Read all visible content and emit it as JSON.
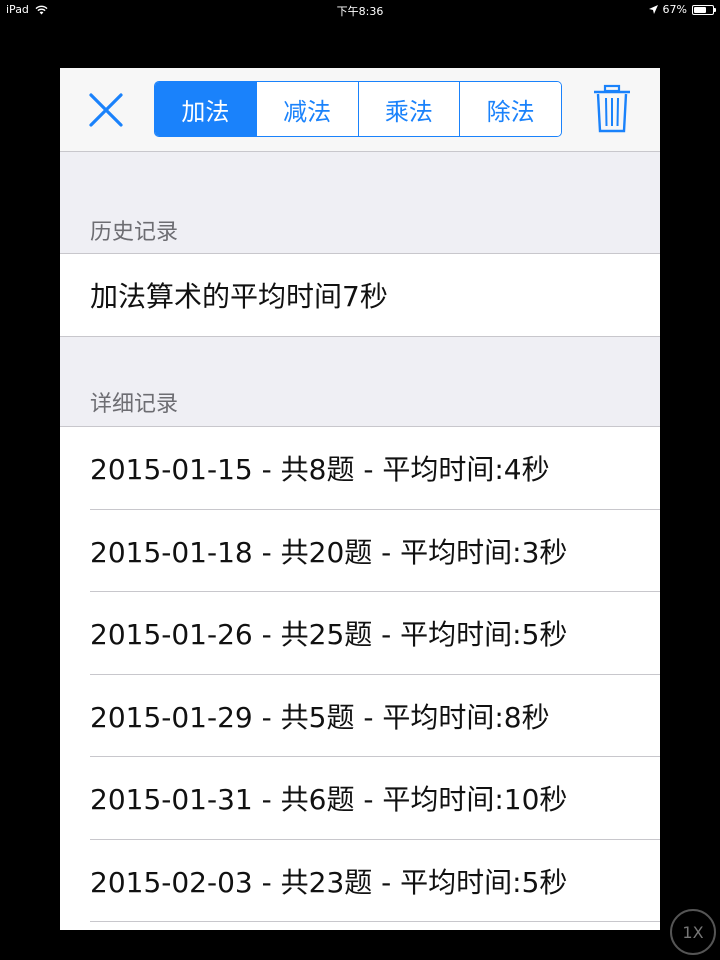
{
  "status_bar": {
    "device": "iPad",
    "time": "下午8:36",
    "battery_percent": "67%",
    "battery_level": 0.67,
    "icons": [
      "wifi-icon",
      "location-arrow-icon",
      "battery-icon"
    ]
  },
  "toolbar": {
    "close_icon": "close-icon",
    "segments": [
      {
        "label": "加法",
        "active": true
      },
      {
        "label": "减法",
        "active": false
      },
      {
        "label": "乘法",
        "active": false
      },
      {
        "label": "除法",
        "active": false
      }
    ],
    "trash_icon": "trash-icon",
    "accent_color": "#1a82fb"
  },
  "history": {
    "header": "历史记录",
    "summary": "加法算术的平均时间7秒"
  },
  "details": {
    "header": "详细记录",
    "items": [
      "2015-01-15 - 共8题 - 平均时间:4秒",
      "2015-01-18 - 共20题 - 平均时间:3秒",
      "2015-01-26 - 共25题 - 平均时间:5秒",
      "2015-01-29 - 共5题 - 平均时间:8秒",
      "2015-01-31 - 共6题 - 平均时间:10秒",
      "2015-02-03 - 共23题 - 平均时间:5秒"
    ]
  },
  "zoom_button": "1X"
}
